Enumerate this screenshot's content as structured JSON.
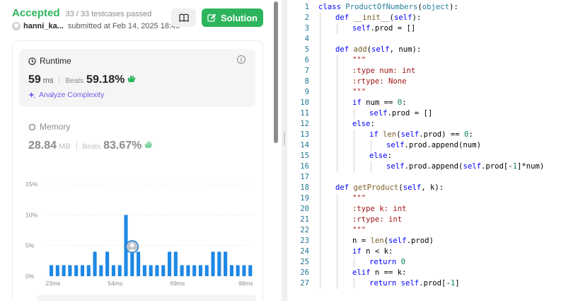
{
  "submission": {
    "status": "Accepted",
    "testcases": "33 / 33 testcases passed",
    "username": "hanni_ka...",
    "submitted_at": "submitted at Feb 14, 2025 18:40",
    "solution_label": "Solution"
  },
  "runtime": {
    "title": "Runtime",
    "value": "59",
    "unit": "ms",
    "beats_label": "Beats",
    "beats_value": "59.18%",
    "analyze_label": "Analyze Complexity"
  },
  "memory": {
    "title": "Memory",
    "value": "28.84",
    "unit": "MB",
    "beats_label": "Beats",
    "beats_value": "83.67%"
  },
  "colors": {
    "accent_green": "#2db55d",
    "bar_blue": "#1e88e5",
    "analyze_purple": "#6b5ce7"
  },
  "chart_data": {
    "type": "bar",
    "y_ticks": [
      "15%",
      "10%",
      "5%",
      "0%"
    ],
    "ylim": [
      0,
      15
    ],
    "x_ticks": [
      "23ms",
      "54ms",
      "69ms",
      "98ms"
    ],
    "values": [
      1.8,
      1.8,
      1.8,
      1.8,
      1.8,
      1.8,
      1.8,
      4,
      1.8,
      4,
      1.8,
      1.8,
      10,
      4,
      4,
      1.8,
      1.8,
      1.8,
      1.8,
      4,
      4,
      1.8,
      1.8,
      1.8,
      1.8,
      1.8,
      4,
      4,
      4,
      1.8,
      1.8,
      1.8,
      1.8
    ],
    "highlight_index": 13,
    "grid": true
  },
  "code": {
    "lines": [
      {
        "n": "1",
        "indent": 0,
        "segs": [
          [
            "kw",
            "class "
          ],
          [
            "ty",
            "ProductOfNumbers"
          ],
          [
            "",
            "("
          ],
          [
            "ty",
            "object"
          ],
          [
            "",
            "):"
          ]
        ]
      },
      {
        "n": "2",
        "indent": 1,
        "segs": [
          [
            "kw",
            "def "
          ],
          [
            "fn",
            "__init__"
          ],
          [
            "",
            "("
          ],
          [
            "kw",
            "self"
          ],
          [
            "",
            "):"
          ]
        ]
      },
      {
        "n": "3",
        "indent": 2,
        "segs": [
          [
            "kw",
            "self"
          ],
          [
            "",
            ".prod = []"
          ]
        ]
      },
      {
        "n": "4",
        "indent": 0,
        "segs": []
      },
      {
        "n": "5",
        "indent": 1,
        "segs": [
          [
            "kw",
            "def "
          ],
          [
            "fn",
            "add"
          ],
          [
            "",
            "("
          ],
          [
            "kw",
            "self"
          ],
          [
            "",
            ", num):"
          ]
        ]
      },
      {
        "n": "6",
        "indent": 2,
        "segs": [
          [
            "st",
            "\"\"\""
          ]
        ]
      },
      {
        "n": "7",
        "indent": 2,
        "segs": [
          [
            "st",
            ":type num: int"
          ]
        ]
      },
      {
        "n": "8",
        "indent": 2,
        "segs": [
          [
            "st",
            ":rtype: None"
          ]
        ]
      },
      {
        "n": "9",
        "indent": 2,
        "segs": [
          [
            "st",
            "\"\"\""
          ]
        ]
      },
      {
        "n": "10",
        "indent": 2,
        "segs": [
          [
            "kw",
            "if "
          ],
          [
            "",
            "num == "
          ],
          [
            "nm",
            "0"
          ],
          [
            "",
            ":"
          ]
        ]
      },
      {
        "n": "11",
        "indent": 3,
        "segs": [
          [
            "kw",
            "self"
          ],
          [
            "",
            ".prod = []"
          ]
        ]
      },
      {
        "n": "12",
        "indent": 2,
        "segs": [
          [
            "kw",
            "else"
          ],
          [
            "",
            ":"
          ]
        ]
      },
      {
        "n": "13",
        "indent": 3,
        "segs": [
          [
            "kw",
            "if "
          ],
          [
            "fn",
            "len"
          ],
          [
            "",
            "("
          ],
          [
            "kw",
            "self"
          ],
          [
            "",
            ".prod) == "
          ],
          [
            "nm",
            "0"
          ],
          [
            "",
            ":"
          ]
        ]
      },
      {
        "n": "14",
        "indent": 4,
        "segs": [
          [
            "kw",
            "self"
          ],
          [
            "",
            ".prod.append(num)"
          ]
        ]
      },
      {
        "n": "15",
        "indent": 3,
        "segs": [
          [
            "kw",
            "else"
          ],
          [
            "",
            ":"
          ]
        ]
      },
      {
        "n": "16",
        "indent": 4,
        "segs": [
          [
            "kw",
            "self"
          ],
          [
            "",
            ".prod.append("
          ],
          [
            "kw",
            "self"
          ],
          [
            "",
            ".prod[-"
          ],
          [
            "nm",
            "1"
          ],
          [
            "",
            "]*num)"
          ]
        ]
      },
      {
        "n": "17",
        "indent": 0,
        "segs": []
      },
      {
        "n": "18",
        "indent": 1,
        "segs": [
          [
            "kw",
            "def "
          ],
          [
            "fn",
            "getProduct"
          ],
          [
            "",
            "("
          ],
          [
            "kw",
            "self"
          ],
          [
            "",
            ", k):"
          ]
        ]
      },
      {
        "n": "19",
        "indent": 2,
        "segs": [
          [
            "st",
            "\"\"\""
          ]
        ]
      },
      {
        "n": "20",
        "indent": 2,
        "segs": [
          [
            "st",
            ":type k: int"
          ]
        ]
      },
      {
        "n": "21",
        "indent": 2,
        "segs": [
          [
            "st",
            ":rtype: int"
          ]
        ]
      },
      {
        "n": "22",
        "indent": 2,
        "segs": [
          [
            "st",
            "\"\"\""
          ]
        ]
      },
      {
        "n": "23",
        "indent": 2,
        "segs": [
          [
            "",
            "n = "
          ],
          [
            "fn",
            "len"
          ],
          [
            "",
            "("
          ],
          [
            "kw",
            "self"
          ],
          [
            "",
            ".prod)"
          ]
        ]
      },
      {
        "n": "24",
        "indent": 2,
        "segs": [
          [
            "kw",
            "if "
          ],
          [
            "",
            "n < k:"
          ]
        ]
      },
      {
        "n": "25",
        "indent": 3,
        "segs": [
          [
            "kw",
            "return "
          ],
          [
            "nm",
            "0"
          ]
        ]
      },
      {
        "n": "26",
        "indent": 2,
        "segs": [
          [
            "kw",
            "elif "
          ],
          [
            "",
            "n == k:"
          ]
        ]
      },
      {
        "n": "27",
        "indent": 3,
        "segs": [
          [
            "kw",
            "return "
          ],
          [
            "kw",
            "self"
          ],
          [
            "",
            ".prod[-"
          ],
          [
            "nm",
            "1"
          ],
          [
            "",
            "]"
          ]
        ]
      }
    ]
  }
}
